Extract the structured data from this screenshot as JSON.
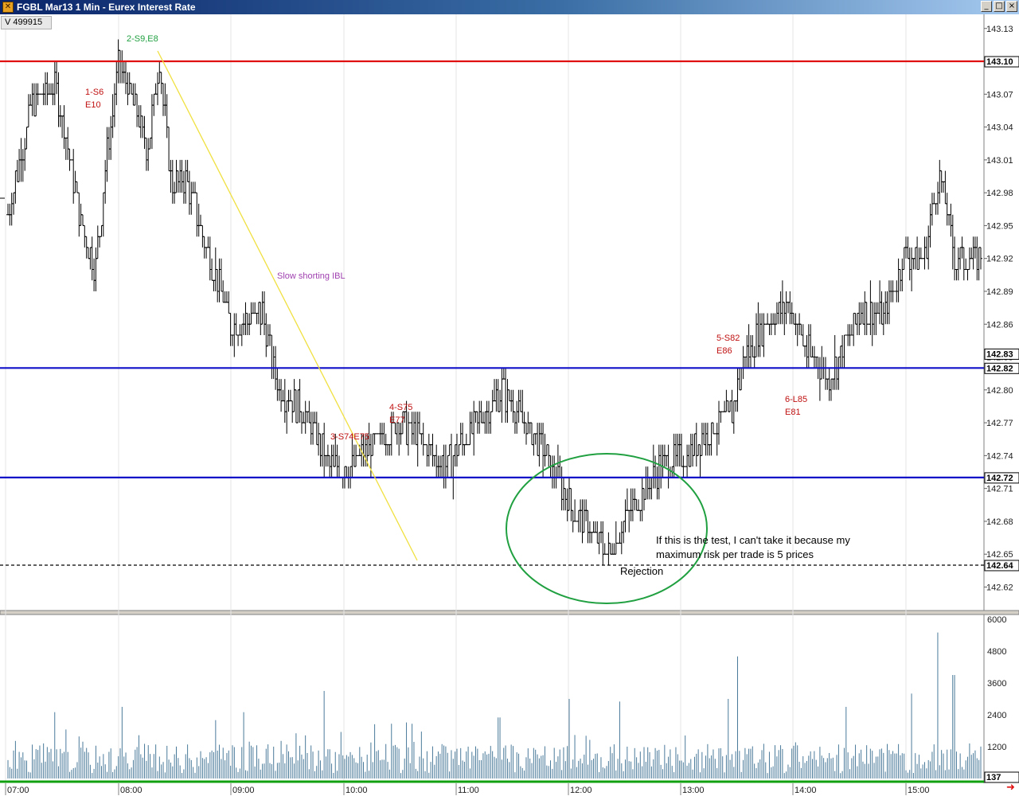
{
  "window": {
    "title": "FGBL Mar13 1 Min - Eurex Interest Rate",
    "controls": [
      "_",
      "□",
      "×"
    ]
  },
  "volume_readout": "V  499915",
  "colors": {
    "resistance_line": "#e01010",
    "support_line": "#1010c8",
    "trendline": "#f0e040",
    "circle": "#20a040",
    "annotation_red": "#c01010",
    "annotation_green": "#20a040",
    "annotation_purple": "#a040b0",
    "volume_bar": "#4a7a9a",
    "axis_green": "#10a010"
  },
  "price_axis": {
    "min": 142.6,
    "max": 143.14,
    "ticks": [
      "143.13",
      "143.10",
      "143.07",
      "143.04",
      "143.01",
      "142.98",
      "142.95",
      "142.92",
      "142.89",
      "142.86",
      "142.83",
      "142.80",
      "142.77",
      "142.74",
      "142.71",
      "142.68",
      "142.65",
      "142.62"
    ],
    "labels": [
      {
        "text": "143.10",
        "value": 143.1
      },
      {
        "text": "142.83",
        "value": 142.833
      },
      {
        "text": "142.82",
        "value": 142.82
      },
      {
        "text": "142.72",
        "value": 142.72
      },
      {
        "text": "142.64",
        "value": 142.64
      }
    ]
  },
  "time_axis": {
    "ticks": [
      "07:00",
      "08:00",
      "09:00",
      "10:00",
      "11:00",
      "12:00",
      "13:00",
      "14:00",
      "15:00"
    ]
  },
  "volume_axis": {
    "ticks": [
      "6000",
      "4800",
      "3600",
      "2400",
      "1200"
    ],
    "current": "137"
  },
  "levels": [
    {
      "name": "resistance",
      "value": 143.1,
      "style": "solid",
      "color": "#e01010"
    },
    {
      "name": "upper-support",
      "value": 142.82,
      "style": "solid",
      "color": "#1010c8"
    },
    {
      "name": "lower-support",
      "value": 142.72,
      "style": "solid",
      "color": "#1010c8"
    },
    {
      "name": "low",
      "value": 142.64,
      "style": "dashed",
      "color": "#000000"
    }
  ],
  "annotations": [
    {
      "lines": [
        "2-S9,E8"
      ],
      "color": "#20a040"
    },
    {
      "lines": [
        "1-S6",
        "E10"
      ],
      "color": "#c01010"
    },
    {
      "lines": [
        "Slow shorting IBL"
      ],
      "color": "#a040b0"
    },
    {
      "lines": [
        "3-S74E75"
      ],
      "color": "#c01010"
    },
    {
      "lines": [
        "4-S75",
        "E77"
      ],
      "color": "#c01010"
    },
    {
      "lines": [
        "5-S82",
        "E86"
      ],
      "color": "#c01010"
    },
    {
      "lines": [
        "6-L85",
        "E81"
      ],
      "color": "#c01010"
    },
    {
      "lines": [
        "If this is the test, I can't take it because my",
        "maximum risk per trade is 5 prices"
      ],
      "color": "#000000"
    },
    {
      "lines": [
        "Rejection"
      ],
      "color": "#000000"
    }
  ],
  "chart_data": {
    "type": "bar",
    "price_path_anchors": [
      [
        0,
        142.92
      ],
      [
        15,
        142.98
      ],
      [
        40,
        143.06
      ],
      [
        70,
        143.08
      ],
      [
        100,
        142.96
      ],
      [
        120,
        142.91
      ],
      [
        135,
        143.02
      ],
      [
        150,
        143.1
      ],
      [
        185,
        143.02
      ],
      [
        200,
        143.1
      ],
      [
        215,
        142.99
      ],
      [
        235,
        142.99
      ],
      [
        260,
        142.93
      ],
      [
        290,
        142.86
      ],
      [
        330,
        142.87
      ],
      [
        350,
        142.8
      ],
      [
        380,
        142.78
      ],
      [
        415,
        142.73
      ],
      [
        440,
        142.73
      ],
      [
        470,
        142.75
      ],
      [
        500,
        142.77
      ],
      [
        520,
        142.76
      ],
      [
        560,
        142.73
      ],
      [
        600,
        142.77
      ],
      [
        630,
        142.8
      ],
      [
        660,
        142.77
      ],
      [
        700,
        142.72
      ],
      [
        720,
        142.69
      ],
      [
        745,
        142.67
      ],
      [
        765,
        142.65
      ],
      [
        790,
        142.69
      ],
      [
        830,
        142.73
      ],
      [
        860,
        142.74
      ],
      [
        890,
        142.76
      ],
      [
        920,
        142.78
      ],
      [
        935,
        142.83
      ],
      [
        960,
        142.86
      ],
      [
        990,
        142.88
      ],
      [
        1010,
        142.84
      ],
      [
        1040,
        142.81
      ],
      [
        1080,
        142.87
      ],
      [
        1110,
        142.87
      ],
      [
        1135,
        142.92
      ],
      [
        1160,
        142.92
      ],
      [
        1180,
        143.0
      ],
      [
        1200,
        142.92
      ],
      [
        1235,
        142.92
      ]
    ],
    "volume_peaks": [
      {
        "t": 408,
        "value": 3300
      },
      {
        "t": 926,
        "value": 4600
      },
      {
        "t": 1177,
        "value": 5500
      },
      {
        "t": 1198,
        "value": 3900
      },
      {
        "t": 1145,
        "value": 3200
      },
      {
        "t": 716,
        "value": 3000
      },
      {
        "t": 778,
        "value": 2900
      },
      {
        "t": 915,
        "value": 3000
      },
      {
        "t": 1063,
        "value": 2700
      },
      {
        "t": 153,
        "value": 2700
      },
      {
        "t": 306,
        "value": 2500
      },
      {
        "t": 627,
        "value": 2300
      },
      {
        "t": 270,
        "value": 2200
      },
      {
        "t": 68,
        "value": 2500
      }
    ]
  }
}
